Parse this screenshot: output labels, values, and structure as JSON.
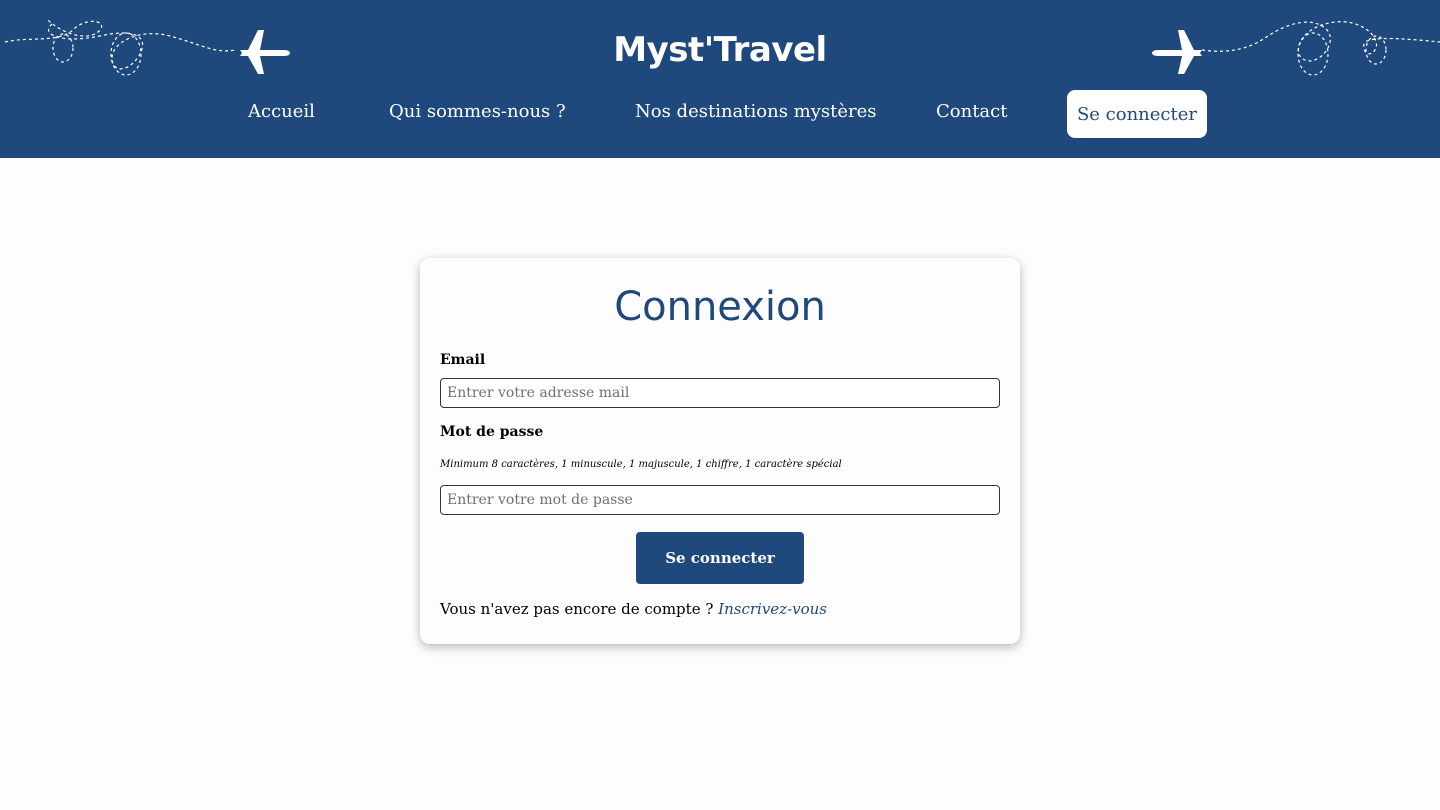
{
  "header": {
    "brand": "Myst'Travel",
    "nav": {
      "home": "Accueil",
      "about": "Qui sommes-nous ?",
      "destinations": "Nos destinations mystères",
      "contact": "Contact",
      "login": "Se connecter"
    }
  },
  "login_card": {
    "title": "Connexion",
    "email_label": "Email",
    "email_placeholder": "Entrer votre adresse mail",
    "password_label": "Mot de passe",
    "password_hint": "Minimum 8 caractères, 1 minuscule, 1 majuscule, 1 chiffre, 1 caractère spécial",
    "password_placeholder": "Entrer votre mot de passe",
    "submit_label": "Se connecter",
    "signup_prompt": "Vous n'avez pas encore de compte ?",
    "signup_link": "Inscrivez-vous"
  },
  "colors": {
    "primary": "#1f497d",
    "background": "#fdfdfd",
    "on_primary": "#ffffff"
  },
  "icons": [
    "airplane-icon",
    "dashed-flight-path"
  ]
}
